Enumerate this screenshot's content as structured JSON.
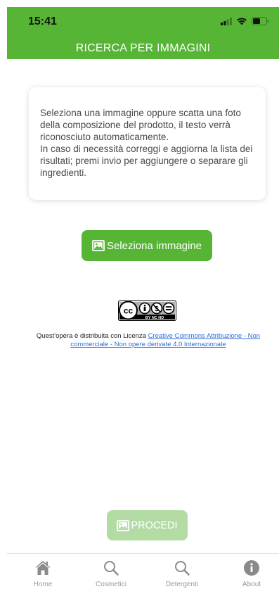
{
  "status_bar": {
    "time": "15:41"
  },
  "header": {
    "title": "RICERCA PER IMMAGINI"
  },
  "info": {
    "text": "Seleziona una immagine oppure scatta una foto della composizione del prodotto, il testo verrà riconosciuto automaticamente.\nIn caso di necessità correggi e aggiorna la lista dei risultati; premi invio per aggiungere o separare gli ingredienti."
  },
  "select_button": {
    "label": "Seleziona immagine",
    "icon": "image-icon"
  },
  "license": {
    "badge_text": "BY NC ND",
    "prefix": "Quest'opera è distribuita con Licenza ",
    "link_text": "Creative Commons Attribuzione - Non commerciale - Non opere derivate 4.0 Internazionale"
  },
  "procedi_button": {
    "label": "PROCEDI",
    "icon": "image-icon",
    "enabled": false
  },
  "nav": {
    "items": [
      {
        "label": "Home",
        "icon": "home-icon"
      },
      {
        "label": "Cosmetici",
        "icon": "search-icon"
      },
      {
        "label": "Detergenti",
        "icon": "search-icon"
      },
      {
        "label": "About",
        "icon": "info-icon"
      }
    ]
  },
  "colors": {
    "brand_green": "#57b536",
    "disabled_green": "#b3dca5",
    "link_blue": "#2f6fd6"
  }
}
